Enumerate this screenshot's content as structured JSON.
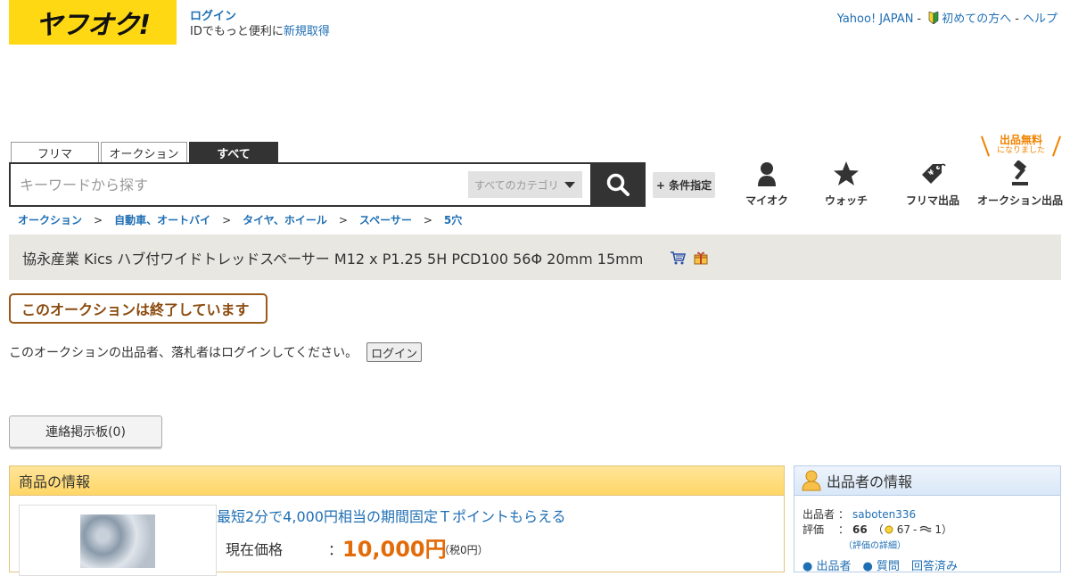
{
  "header": {
    "logo_text": "ヤフオク!",
    "login_link": "ログイン",
    "login_sub_prefix": "IDでもっと便利に",
    "signup_link": "新規取得",
    "links": [
      "Yahoo! JAPAN",
      "初めての方へ",
      "ヘルプ"
    ],
    "sep": "-"
  },
  "search": {
    "tabs": [
      "フリマ",
      "オークション",
      "すべて"
    ],
    "active_tab": "すべて",
    "placeholder": "キーワードから探す",
    "category": "すべてのカテゴリ",
    "condition_button": "+ 条件指定"
  },
  "nav": {
    "items": [
      {
        "label": "マイオク",
        "icon": "person-icon"
      },
      {
        "label": "ウォッチ",
        "icon": "star-icon"
      },
      {
        "label": "フリマ出品",
        "icon": "tag-icon"
      },
      {
        "label": "オークション出品",
        "icon": "gavel-icon"
      }
    ],
    "promo_big": "出品無料",
    "promo_small": "になりました"
  },
  "breadcrumb": [
    "オークション",
    "自動車、オートバイ",
    "タイヤ、ホイール",
    "スペーサー",
    "5穴"
  ],
  "breadcrumb_sep": ">",
  "item": {
    "title": "協永産業 Kics ハブ付ワイドトレッドスペーサー M12 x P1.25 5H PCD100 56Φ 20mm 15mm",
    "ended_label": "このオークションは終了しています",
    "login_note": "このオークションの出品者、落札者はログインしてください。",
    "login_button": "ログイン",
    "board_button": "連絡掲示板(0)",
    "info_header": "商品の情報",
    "tpoint_promo": "最短2分で4,000円相当の期間固定Ｔポイントもらえる",
    "price_label": "現在価格",
    "price_colon": "：",
    "price_value": "10,000円",
    "price_tax": "（税0円）"
  },
  "seller": {
    "header": "出品者の情報",
    "label_seller": "出品者",
    "colon": "：",
    "seller_id": "saboten336",
    "label_rating": "評価",
    "rating_total": "66",
    "rating_good": "67",
    "rating_bad": "1",
    "rating_detail": "（評価の詳細）",
    "bottom_links": "● 出品者　● 質問　回答済み"
  },
  "colors": {
    "brand_yellow": "#ffd814",
    "link_blue": "#1f6fb4",
    "price_orange": "#e36c0a",
    "ended_brown": "#8b4b0f"
  }
}
